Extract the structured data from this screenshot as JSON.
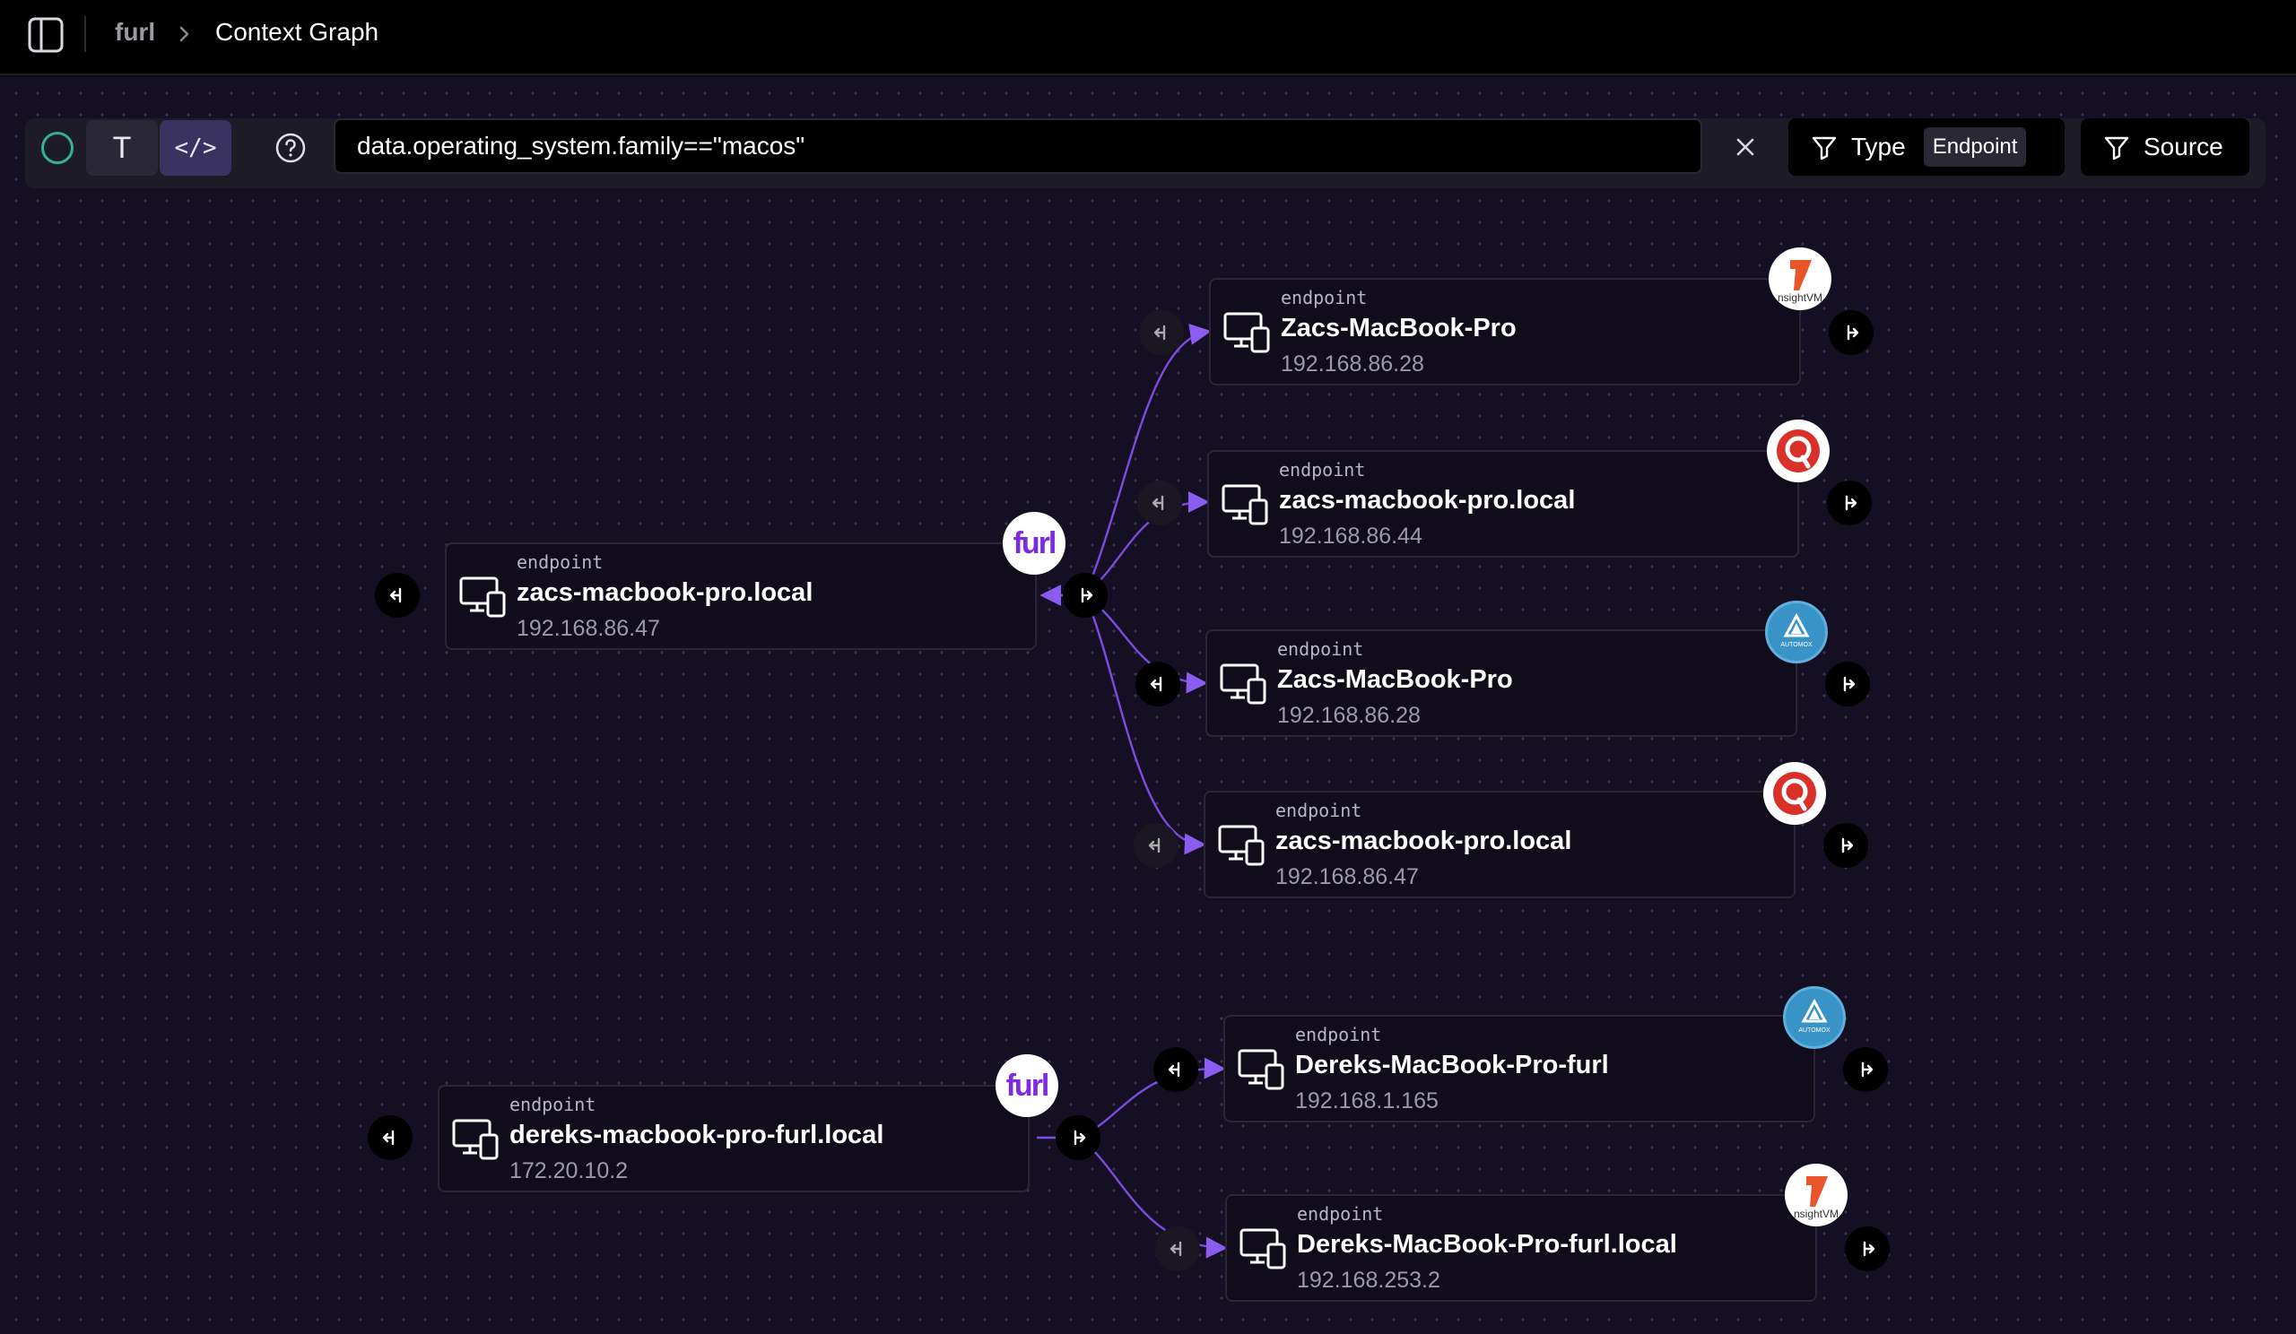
{
  "header": {
    "breadcrumb_root": "furl",
    "breadcrumb_current": "Context Graph"
  },
  "toolbar": {
    "mode_text_glyph": "T",
    "mode_code_glyph": "</>",
    "query_value": "data.operating_system.family==\"macos\"",
    "filter_type_label": "Type",
    "filter_type_chip": "Endpoint",
    "filter_source_label": "Source"
  },
  "colors": {
    "accent_purple": "#7c4ce0",
    "status_green": "#2fb58f",
    "furl_purple": "#7c2be0",
    "insight_orange": "#e9552b",
    "qualys_red": "#d9302a",
    "automox_blue": "#3a93c7"
  },
  "nodes": [
    {
      "type": "endpoint",
      "name": "zacs-macbook-pro.local",
      "ip": "192.168.86.47",
      "source_icon": "furl-logo",
      "source_text": "furl"
    },
    {
      "type": "endpoint",
      "name": "Zacs-MacBook-Pro",
      "ip": "192.168.86.28",
      "source_icon": "insightvm-logo",
      "source_text": "nsightVM"
    },
    {
      "type": "endpoint",
      "name": "zacs-macbook-pro.local",
      "ip": "192.168.86.44",
      "source_icon": "qualys-logo"
    },
    {
      "type": "endpoint",
      "name": "Zacs-MacBook-Pro",
      "ip": "192.168.86.28",
      "source_icon": "automox-logo",
      "source_text": "AUTOMOX"
    },
    {
      "type": "endpoint",
      "name": "zacs-macbook-pro.local",
      "ip": "192.168.86.47",
      "source_icon": "qualys-logo"
    },
    {
      "type": "endpoint",
      "name": "dereks-macbook-pro-furl.local",
      "ip": "172.20.10.2",
      "source_icon": "furl-logo",
      "source_text": "furl"
    },
    {
      "type": "endpoint",
      "name": "Dereks-MacBook-Pro-furl",
      "ip": "192.168.1.165",
      "source_icon": "automox-logo",
      "source_text": "AUTOMOX"
    },
    {
      "type": "endpoint",
      "name": "Dereks-MacBook-Pro-furl.local",
      "ip": "192.168.253.2",
      "source_icon": "insightvm-logo",
      "source_text": "nsightVM"
    }
  ]
}
